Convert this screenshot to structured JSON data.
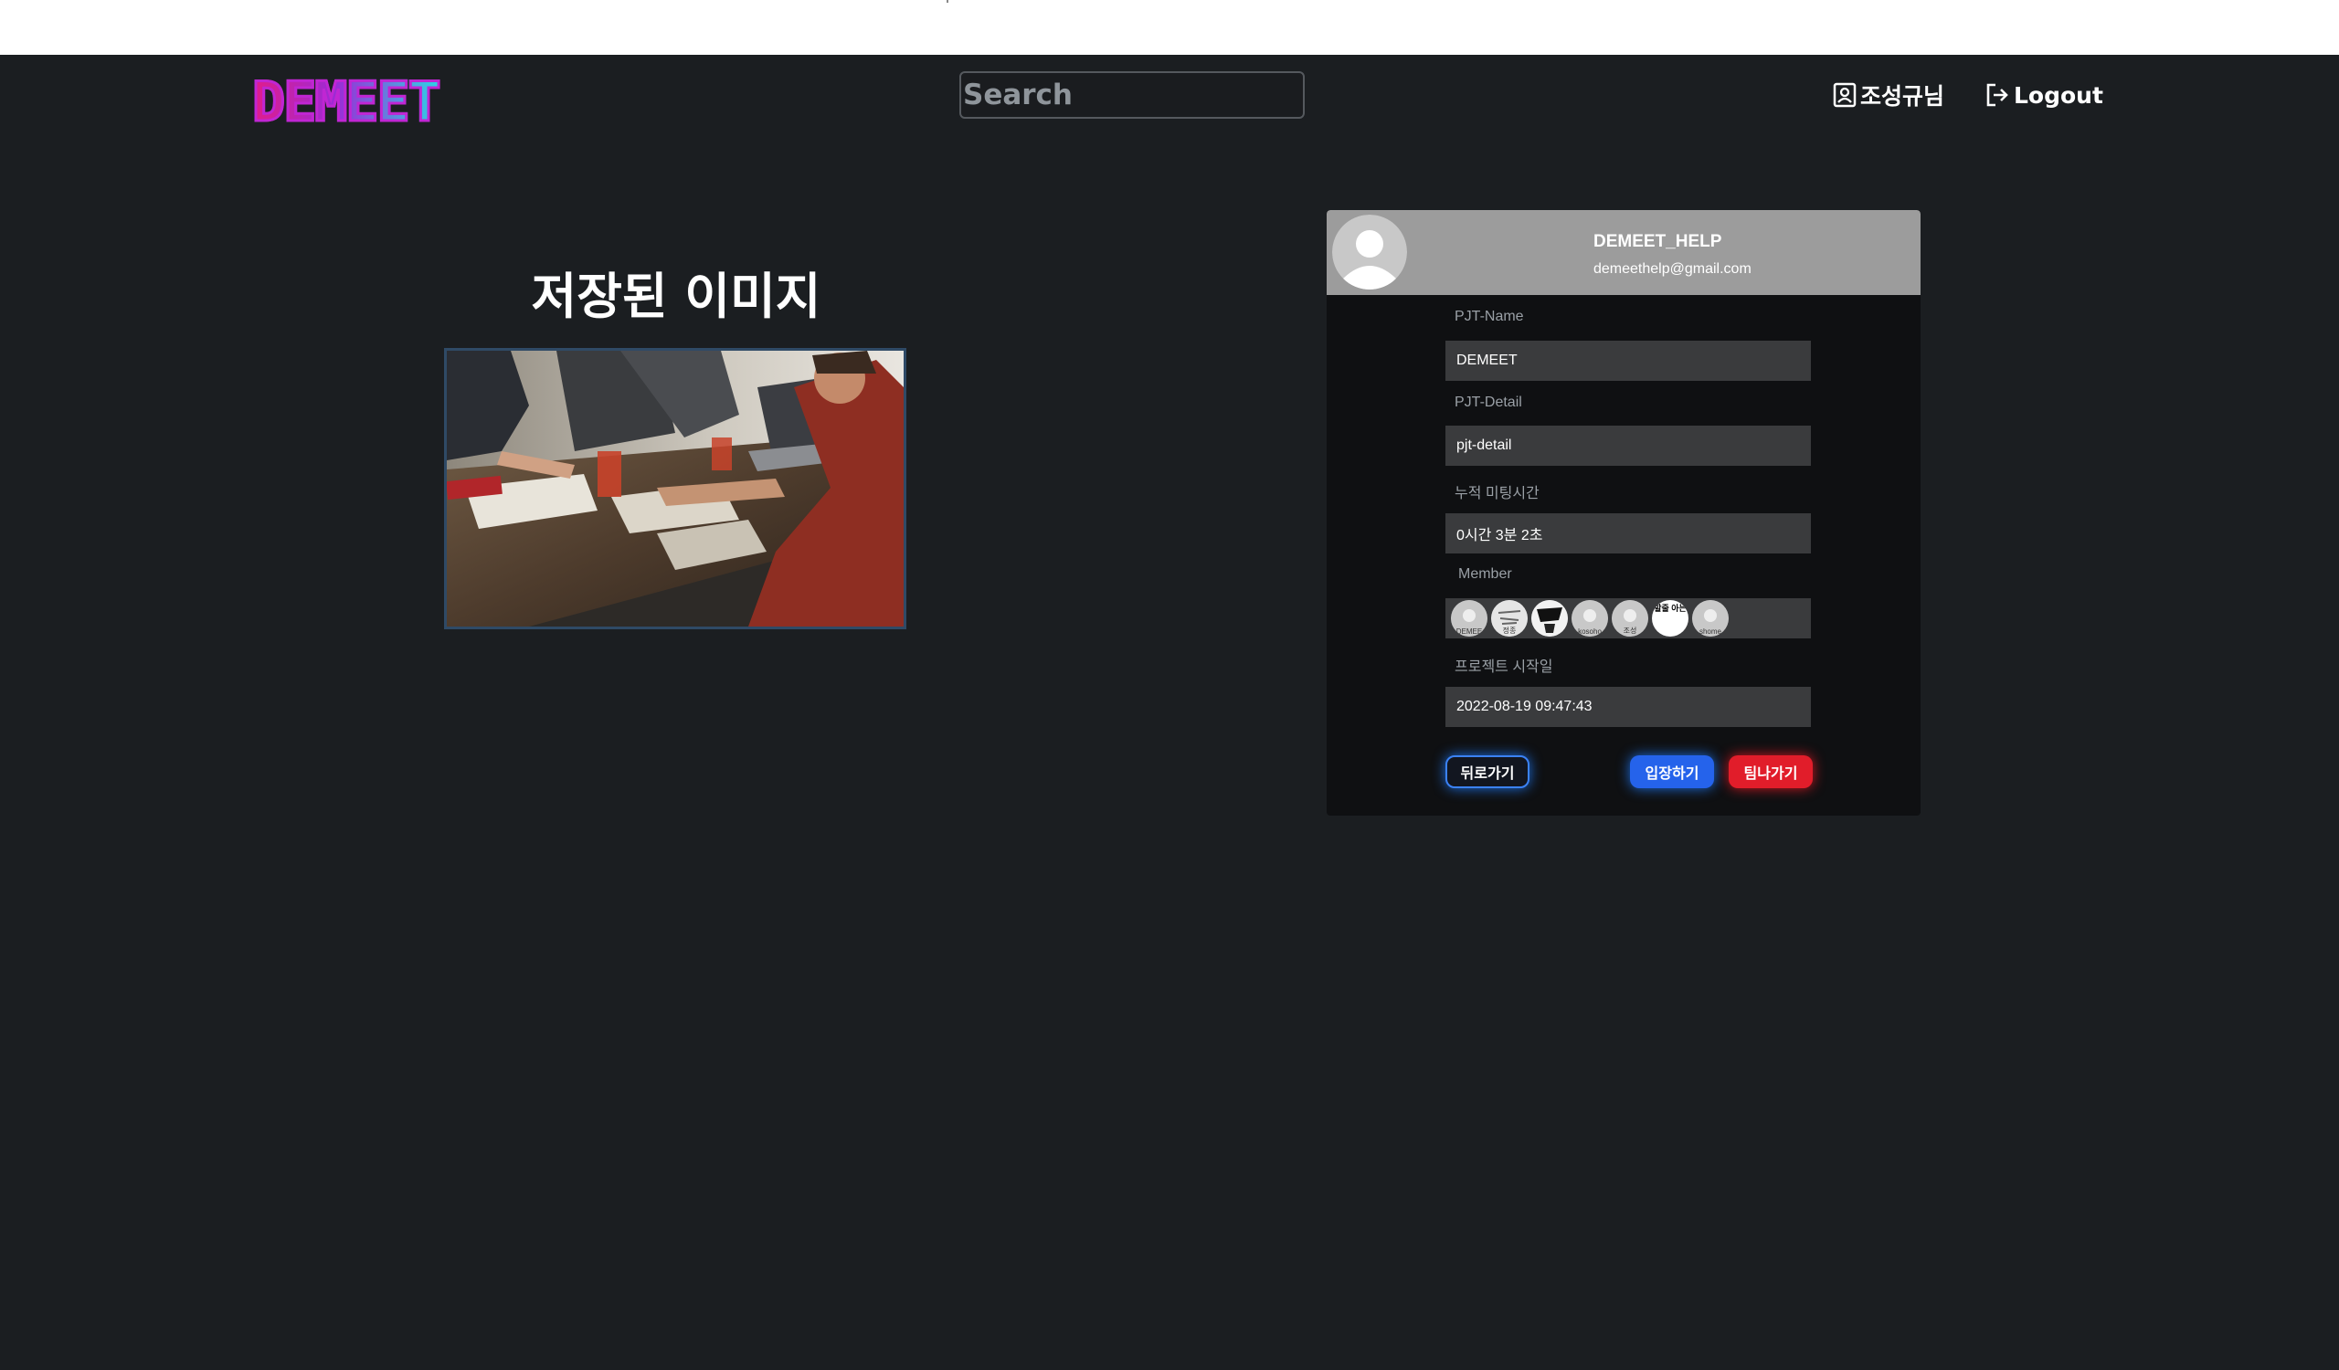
{
  "header": {
    "logo": "DEMEET",
    "search_placeholder": "Search",
    "user_label": "조성규님",
    "logout_label": "Logout"
  },
  "main": {
    "saved_image_title": "저장된 이미지"
  },
  "card": {
    "owner_name": "DEMEET_HELP",
    "owner_email": "demeethelp@gmail.com",
    "fields": {
      "name_label": "PJT-Name",
      "name_value": "DEMEET",
      "detail_label": "PJT-Detail",
      "detail_value": "pjt-detail",
      "time_label": "누적 미팅시간",
      "time_value": "0시간 3분 2초",
      "member_label": "Member",
      "start_label": "프로젝트 시작일",
      "start_value": "2022-08-19 09:47:43"
    },
    "members": [
      "DEMEE",
      "정종",
      "",
      "kosoho",
      "조성",
      "할줄 아는",
      "shome"
    ],
    "buttons": {
      "back": "뒤로가기",
      "enter": "입장하기",
      "leave": "팀나가기"
    }
  }
}
